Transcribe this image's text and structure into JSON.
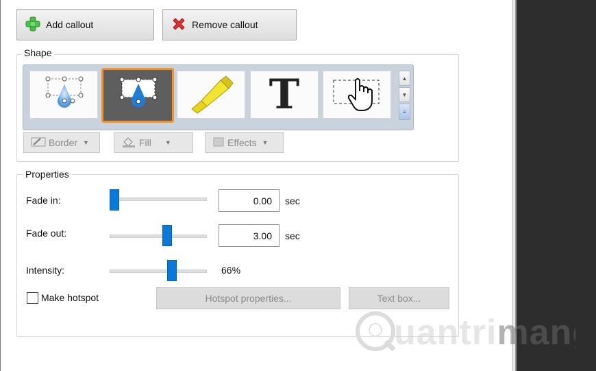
{
  "toolbar": {
    "add_callout": "Add callout",
    "remove_callout": "Remove callout"
  },
  "shape": {
    "legend": "Shape",
    "tiles": [
      {
        "icon": "spotlight-callout-icon",
        "selected": false
      },
      {
        "icon": "spotlight-callout-dark-icon",
        "selected": true
      },
      {
        "icon": "highlighter-icon",
        "selected": false
      },
      {
        "icon": "text-t-icon",
        "selected": false
      },
      {
        "icon": "hand-cursor-icon",
        "selected": false
      }
    ],
    "border_label": "Border",
    "fill_label": "Fill",
    "effects_label": "Effects"
  },
  "properties": {
    "legend": "Properties",
    "fade_in_label": "Fade in:",
    "fade_in_value": "0.00",
    "fade_in_unit": "sec",
    "fade_in_slider": 0.0,
    "fade_out_label": "Fade out:",
    "fade_out_value": "3.00",
    "fade_out_unit": "sec",
    "fade_out_slider": 0.6,
    "intensity_label": "Intensity:",
    "intensity_value": "66%",
    "intensity_slider": 0.66,
    "hotspot_label": "Make hotspot",
    "hotspot_checked": false,
    "hotspot_properties_label": "Hotspot properties...",
    "text_box_label": "Text box..."
  },
  "watermark": {
    "text": "uantrimang"
  },
  "colors": {
    "accent": "#0a79dc",
    "selection": "#f5922a"
  }
}
